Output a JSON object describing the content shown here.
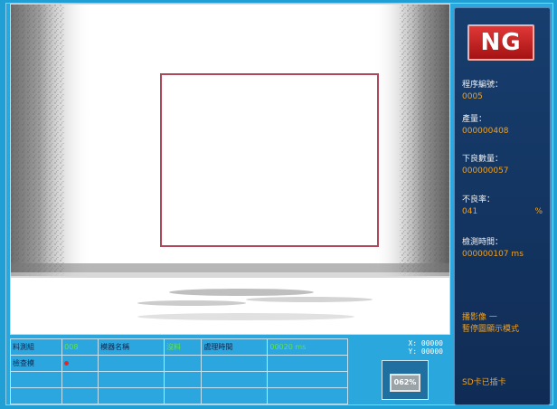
{
  "status": {
    "result": "NG",
    "result_color": "#c81e1e"
  },
  "stats": {
    "program_no": {
      "label": "程序編號：",
      "value": "0005"
    },
    "output": {
      "label": "產量：",
      "value": "000000408"
    },
    "defect_count": {
      "label": "下良數量：",
      "value": "000000057"
    },
    "defect_rate": {
      "label": "不良率：",
      "value": "041",
      "unit": "%"
    },
    "inspect_time": {
      "label": "檢測時間：",
      "value": "000000107",
      "unit": "ms"
    }
  },
  "mode": {
    "line1": "播影像 一",
    "line2": "暫停圖顯示模式"
  },
  "storage": {
    "label": "SD卡已插卡"
  },
  "table": {
    "rows": [
      [
        "料測組",
        "008",
        "模器名稱",
        "沒料",
        "處理時間",
        "00020 ms"
      ],
      [
        "檢查模",
        "",
        "",
        "",
        "",
        ""
      ],
      [
        "",
        "",
        "",
        "",
        "",
        ""
      ],
      [
        "",
        "",
        "",
        "",
        "",
        ""
      ]
    ]
  },
  "coords": {
    "x": "X: 00000",
    "y": "Y: 00000"
  },
  "zoom": {
    "value": "062%"
  },
  "colors": {
    "accent": "#2aa7dc",
    "panel": "#133766",
    "value_text": "#f0a020",
    "table_value": "#5fe24a"
  }
}
